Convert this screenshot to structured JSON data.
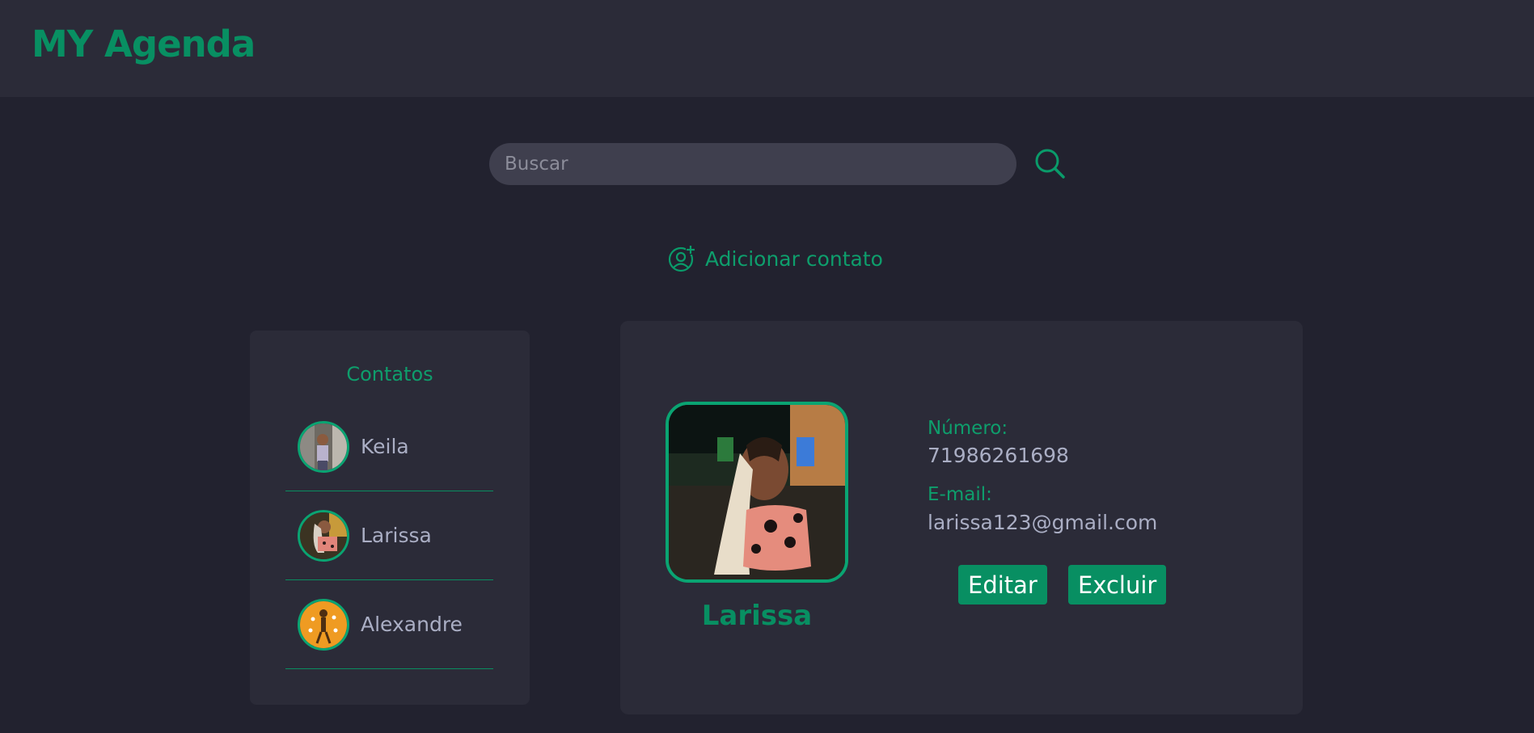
{
  "header": {
    "logo": "MY Agenda"
  },
  "search": {
    "placeholder": "Buscar",
    "value": "",
    "icon": "search-icon"
  },
  "add_contact": {
    "label": "Adicionar contato",
    "icon": "add-user-icon"
  },
  "contacts": {
    "title": "Contatos",
    "items": [
      {
        "name": "Keila"
      },
      {
        "name": "Larissa"
      },
      {
        "name": "Alexandre"
      }
    ]
  },
  "detail": {
    "name": "Larissa",
    "number_label": "Número:",
    "number": "71986261698",
    "email_label": "E-mail:",
    "email": "larissa123@gmail.com",
    "edit_label": "Editar",
    "delete_label": "Excluir"
  },
  "colors": {
    "accent": "#088f62",
    "background": "#22222f",
    "panel": "#2b2b38",
    "input": "#3f3f4e",
    "text_muted": "#aaaec4"
  }
}
